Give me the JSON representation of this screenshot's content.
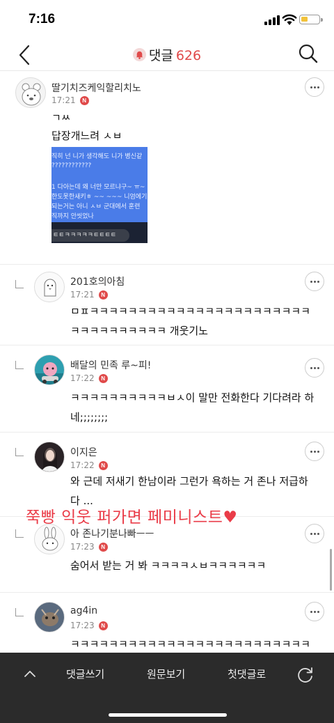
{
  "status_bar": {
    "time": "7:16",
    "battery_color": "#f2c23b",
    "battery_level": 0.4
  },
  "header": {
    "title": "댓글",
    "count": "626",
    "accent": "#e04a4a",
    "back_icon": "chevron-left-icon",
    "search_icon": "search-icon",
    "bell_icon": "bell-icon"
  },
  "comments": [
    {
      "author": "딸기치즈케익할리치노",
      "time": "17:21",
      "badge": "N",
      "lines": [
        "ㄱㅆ",
        "답장개느려 ㅅㅂ"
      ],
      "image": {
        "text_lines": [
          "직히 넌 니가 생각해도 니가 병신같",
          "????????????",
          "",
          "1 다아는데 왜 너만 모르냐구~ ㅠ~",
          "한도못한새키ㅎ ~~ ~~~ 니엄에기",
          "되는거는 아니 ㅅㅂ 군대에서 훈련",
          "직까지 안씻었나"
        ],
        "bubble": "ㅌㅌㅋㅋㅋㅋㅋㅌㅌㅌㅌ"
      },
      "reply": false,
      "avatar": "bear-avatar"
    },
    {
      "author": "201호의아침",
      "time": "17:21",
      "badge": "N",
      "lines": [
        "ㅁㅍㅋㅋㅋㅋㅋㅋㅋㅋㅋㅋㅋㅋㅋㅋㅋㅋㅋㅋㅋㅋㅋㅋㅋ",
        "ㅋㅋㅋㅋㅋㅋㅋㅋㅋㅋ 개웃기노"
      ],
      "reply": true,
      "avatar": "penguin-avatar"
    },
    {
      "author": "배달의 민족 루~피!",
      "time": "17:22",
      "badge": "N",
      "lines": [
        "ㅋㅋㅋㅋㅋㅋㅋㅋㅋㅋㅂㅅ이 말만 전화한다 기다려라 하",
        "네;;;;;;;;"
      ],
      "reply": true,
      "avatar": "ruppy-avatar"
    },
    {
      "author": "이지은",
      "time": "17:22",
      "badge": "N",
      "lines": [
        "와 근데 저새기 한남이라 그런가 욕하는 거 존나 저급하",
        "다 ..."
      ],
      "reply": true,
      "avatar": "photo-avatar"
    },
    {
      "author": "아 존나기분나빠ㅡㅡ",
      "time": "17:23",
      "badge": "N",
      "lines": [
        "숨어서 받는 거 봐 ㅋㅋㅋㅋㅅㅂㅋㅋㅋㅋㅋㅋ"
      ],
      "reply": true,
      "avatar": "rabbit-avatar"
    },
    {
      "author": "ag4in",
      "time": "17:23",
      "badge": "N",
      "lines": [
        "ㅋㅋㅋㅋㅋㅋㅋㅋㅋㅋㅋㅋㅋㅋㅋㅋㅋㅋㅋㅋㅋㅋㅋㅋㅋㅋ"
      ],
      "reply": true,
      "avatar": "animal-avatar"
    }
  ],
  "overlay_caption": "쭉빵 익웃 퍼가면 페미니스트♥",
  "bottom_bar": {
    "write": "댓글쓰기",
    "original": "원문보기",
    "first": "첫댓글로",
    "up_icon": "chevron-up-icon",
    "refresh_icon": "refresh-icon"
  }
}
